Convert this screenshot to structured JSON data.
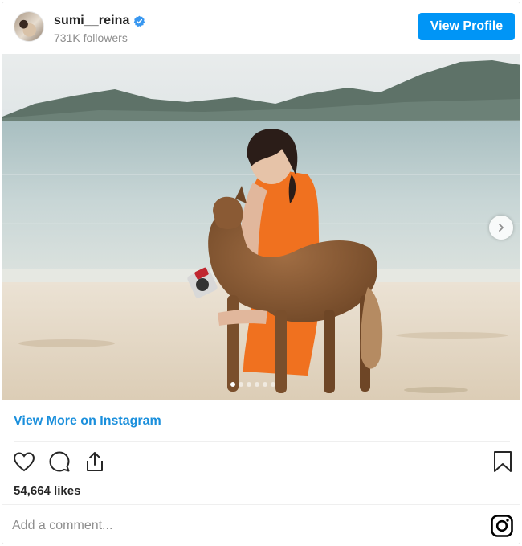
{
  "header": {
    "username": "sumi__reina",
    "verified_icon": "verified-badge-icon",
    "followers": "731K followers",
    "view_profile_label": "View Profile"
  },
  "post": {
    "image_alt": "Woman in orange dress on a beach with a brown dog",
    "carousel": {
      "slide_count": 6,
      "active_index": 0,
      "next_icon": "chevron-right-icon"
    }
  },
  "link": {
    "label": "View More on Instagram"
  },
  "actions": {
    "icons": [
      "heart-icon",
      "comment-icon",
      "share-icon",
      "bookmark-icon"
    ],
    "likes": "54,664 likes"
  },
  "comment": {
    "placeholder": "Add a comment..."
  },
  "colors": {
    "accent": "#0095f6",
    "link": "#1a8fdc",
    "text": "#262626",
    "muted": "#8e8e8e"
  }
}
